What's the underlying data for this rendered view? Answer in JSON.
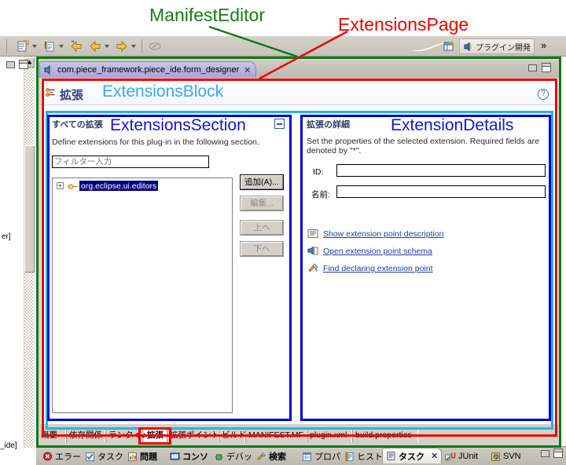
{
  "annotations": {
    "manifest_editor": "ManifestEditor",
    "extensions_page": "ExtensionsPage",
    "extensions_block": "ExtensionsBlock",
    "extensions_section": "ExtensionsSection",
    "extension_details": "ExtensionDetails",
    "colors": {
      "manifest_editor": "#0a7a16",
      "extensions_page": "#ee0000",
      "extensions_block": "#1bb8ef",
      "extensions_section": "#0000dd",
      "extension_details": "#0000dd"
    }
  },
  "toolbar": {
    "perspective_label": "プラグイン開発",
    "overflow_label": "»"
  },
  "left_panel": {
    "text_fragment_1": "er]",
    "text_fragment_2": "_ide]"
  },
  "editor": {
    "tab_title": "com.piece_framework.piece_ide.form_designer",
    "tab_close": "✕"
  },
  "form": {
    "title": "拡張",
    "help_tooltip": "?"
  },
  "extensions_section": {
    "title": "すべての拡張",
    "description": "Define extensions for this plug-in in the following section.",
    "filter_placeholder": "フィルター入力",
    "filter_value": "",
    "tree_items": [
      {
        "label": "org.eclipse.ui.editors",
        "selected": true,
        "expander": "+"
      }
    ],
    "buttons": [
      {
        "label": "追加(A)...",
        "enabled": true
      },
      {
        "label": "編集...",
        "enabled": false
      },
      {
        "label": "上へ",
        "enabled": false
      },
      {
        "label": "下へ",
        "enabled": false
      }
    ]
  },
  "extension_details": {
    "title": "拡張の詳細",
    "description": "Set the properties of the selected extension. Required fields are denoted by \"*\".",
    "fields": [
      {
        "label": "ID:",
        "value": ""
      },
      {
        "label": "名前:",
        "value": ""
      }
    ],
    "links": [
      {
        "label": "Show extension point description",
        "icon": "description-icon"
      },
      {
        "label": "Open extension point schema",
        "icon": "schema-icon"
      },
      {
        "label": "Find declaring extension point",
        "icon": "find-icon"
      }
    ]
  },
  "page_tabs": [
    {
      "label": "概要",
      "active": false
    },
    {
      "label": "依存関係",
      "active": false
    },
    {
      "label": "ランタイム",
      "active": false
    },
    {
      "label": "拡張",
      "active": true
    },
    {
      "label": "拡張ポイント",
      "active": false
    },
    {
      "label": "ビルド",
      "active": false
    },
    {
      "label": "MANIFEST.MF",
      "active": false
    },
    {
      "label": "plugin.xml",
      "active": false
    },
    {
      "label": "build.properties",
      "active": false
    }
  ],
  "view_tabs": [
    {
      "label": "エラー",
      "active": false,
      "icon": "error-icon"
    },
    {
      "label": "タスク",
      "active": false,
      "icon": "task-icon"
    },
    {
      "label": "問題",
      "active": false,
      "icon": "problems-icon",
      "bold": true
    },
    {
      "label": "コンソ",
      "active": false,
      "icon": "console-icon",
      "bold": true
    },
    {
      "label": "デバッ",
      "active": false,
      "icon": "debug-icon"
    },
    {
      "label": "検索",
      "active": false,
      "icon": "search-icon",
      "bold": true
    },
    {
      "label": "プロパ",
      "active": false,
      "icon": "properties-icon"
    },
    {
      "label": "ヒスト",
      "active": false,
      "icon": "history-icon"
    },
    {
      "label": "タスク",
      "active": true,
      "icon": "tasklist-icon",
      "close": "✕"
    },
    {
      "label": "JUnit",
      "active": false,
      "icon": "junit-icon"
    },
    {
      "label": "SVN",
      "active": false,
      "icon": "svn-icon"
    }
  ]
}
